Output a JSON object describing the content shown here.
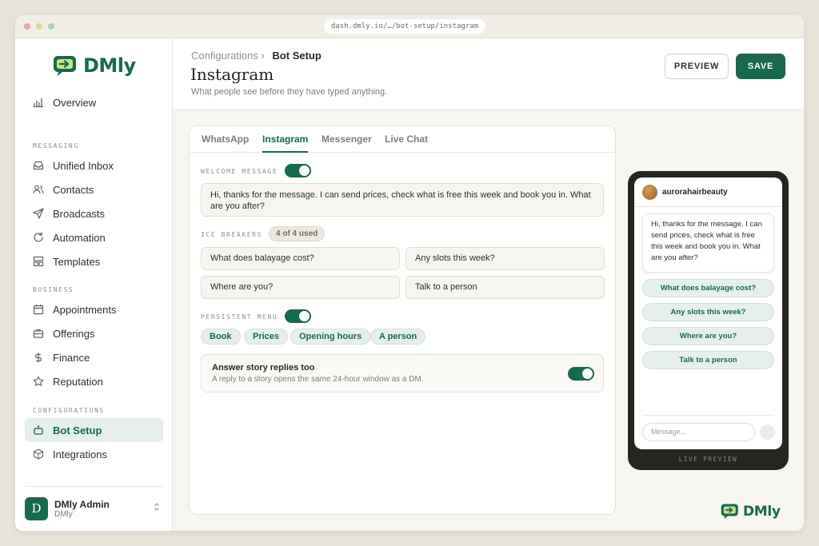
{
  "browser": {
    "url": "dash.dmly.io/…/bot-setup/instagram",
    "dots": [
      "#e9a69b",
      "#e6d39a",
      "#a9d2b7"
    ]
  },
  "colors": {
    "brand": "#17694f",
    "brand_soft": "#e6efe9"
  },
  "sidebar": {
    "logo_text": "DMly",
    "overview": {
      "label": "Overview",
      "icon": "bar-chart-icon"
    },
    "sections": [
      {
        "label": "MESSAGING"
      },
      {
        "label": "BUSINESS"
      },
      {
        "label": "CONFIGURATIONS"
      }
    ],
    "messaging": [
      {
        "label": "Unified Inbox",
        "icon": "inbox-icon"
      },
      {
        "label": "Contacts",
        "icon": "users-icon"
      },
      {
        "label": "Broadcasts",
        "icon": "send-icon"
      },
      {
        "label": "Automation",
        "icon": "refresh-icon"
      },
      {
        "label": "Templates",
        "icon": "layout-icon"
      }
    ],
    "business": [
      {
        "label": "Appointments",
        "icon": "calendar-icon"
      },
      {
        "label": "Offerings",
        "icon": "briefcase-icon"
      },
      {
        "label": "Finance",
        "icon": "dollar-icon"
      },
      {
        "label": "Reputation",
        "icon": "star-icon"
      }
    ],
    "configurations": [
      {
        "label": "Bot Setup",
        "icon": "bot-icon",
        "active": true
      },
      {
        "label": "Integrations",
        "icon": "cube-icon"
      }
    ],
    "user": {
      "initial": "D",
      "name": "DMly Admin",
      "org": "DMly"
    }
  },
  "header": {
    "breadcrumb_parent": "Configurations",
    "breadcrumb_sep": "›",
    "breadcrumb_current": "Bot Setup",
    "title": "Instagram",
    "subtitle": "What people see before they have typed anything.",
    "preview_label": "PREVIEW",
    "save_label": "SAVE"
  },
  "tabs": [
    {
      "label": "WhatsApp"
    },
    {
      "label": "Instagram",
      "active": true
    },
    {
      "label": "Messenger"
    },
    {
      "label": "Live Chat"
    }
  ],
  "welcome": {
    "label": "WELCOME MESSAGE",
    "enabled": true,
    "text": "Hi, thanks for the message. I can send prices, check what is free this week and book you in. What are you after?"
  },
  "ice_breakers": {
    "label": "ICE BREAKERS",
    "badge": "4 of 4 used",
    "items": [
      "What does balayage cost?",
      "Any slots this week?",
      "Where are you?",
      "Talk to a person"
    ]
  },
  "persistent_menu": {
    "label": "PERSISTENT MENU",
    "enabled": true,
    "chips": [
      "Book",
      "Prices",
      "Opening hours",
      "A person"
    ]
  },
  "story": {
    "title": "Answer story replies too",
    "subtitle": "A reply to a story opens the same 24-hour window as a DM.",
    "enabled": true
  },
  "preview": {
    "username": "aurorahairbeauty",
    "message": "Hi, thanks for the message. I can send prices, check what is free this week and book you in. What are you after?",
    "quick_replies": [
      "What does balayage cost?",
      "Any slots this week?",
      "Where are you?",
      "Talk to a person"
    ],
    "input_placeholder": "Message...",
    "caption": "LIVE PREVIEW"
  },
  "footer": {
    "logo_text": "DMly"
  }
}
